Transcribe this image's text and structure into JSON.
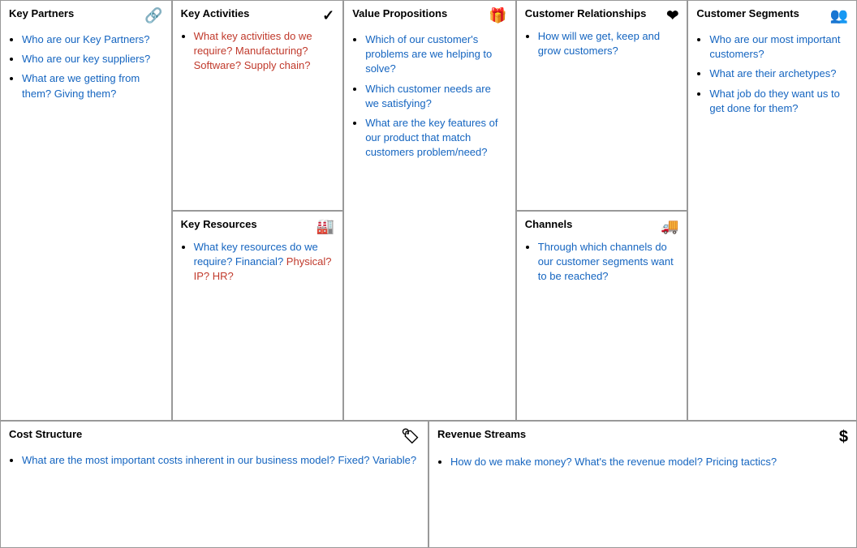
{
  "sections": {
    "keyPartners": {
      "title": "Key Partners",
      "icon": "🔗",
      "items": [
        {
          "text": "Who are our Key Partners?",
          "color": "blue"
        },
        {
          "text": "Who are our key suppliers?",
          "color": "blue"
        },
        {
          "text": "What are we getting from them? Giving them?",
          "color": "blue"
        }
      ]
    },
    "keyActivities": {
      "title": "Key Activities",
      "icon": "✔",
      "items": [
        {
          "text": "What key activities do we require? Manufacturing? Software? Supply chain?",
          "color": "red"
        }
      ]
    },
    "keyResources": {
      "title": "Key Resources",
      "icon": "🏭",
      "items": [
        {
          "text": "What key resources do we require? Financial? ",
          "color": "blue",
          "highlight": "Physical? IP? HR?",
          "highlightColor": "red"
        }
      ]
    },
    "valuePropositions": {
      "title": "Value Propositions",
      "icon": "🎁",
      "items": [
        {
          "text": "Which of our customer's problems are we helping to solve?",
          "color": "blue"
        },
        {
          "text": "Which customer needs are we satisfying?",
          "color": "blue"
        },
        {
          "text": "What are the key features of our product that match customers problem/need?",
          "color": "blue"
        }
      ]
    },
    "customerRelationships": {
      "title": "Customer Relationships",
      "icon": "❤",
      "items": [
        {
          "text": "How will we get, keep and grow customers?",
          "color": "blue"
        }
      ]
    },
    "channels": {
      "title": "Channels",
      "icon": "🚚",
      "items": [
        {
          "text": "Through which channels do our customer segments want to be reached?",
          "color": "blue"
        }
      ]
    },
    "customerSegments": {
      "title": "Customer Segments",
      "icon": "👥",
      "items": [
        {
          "text": "Who are our most important customers?",
          "color": "blue"
        },
        {
          "text": "What are their archetypes?",
          "color": "blue"
        },
        {
          "text": "What job do they want us to get done for them?",
          "color": "blue"
        }
      ]
    },
    "costStructure": {
      "title": "Cost Structure",
      "icon": "🏷",
      "items": [
        {
          "text": "What are the most important costs inherent in our business model? Fixed? Variable?",
          "color": "blue"
        }
      ]
    },
    "revenueStreams": {
      "title": "Revenue Streams",
      "icon": "$",
      "items": [
        {
          "text": "How do we make money? What's the revenue model? Pricing tactics?",
          "color": "blue"
        }
      ]
    }
  }
}
